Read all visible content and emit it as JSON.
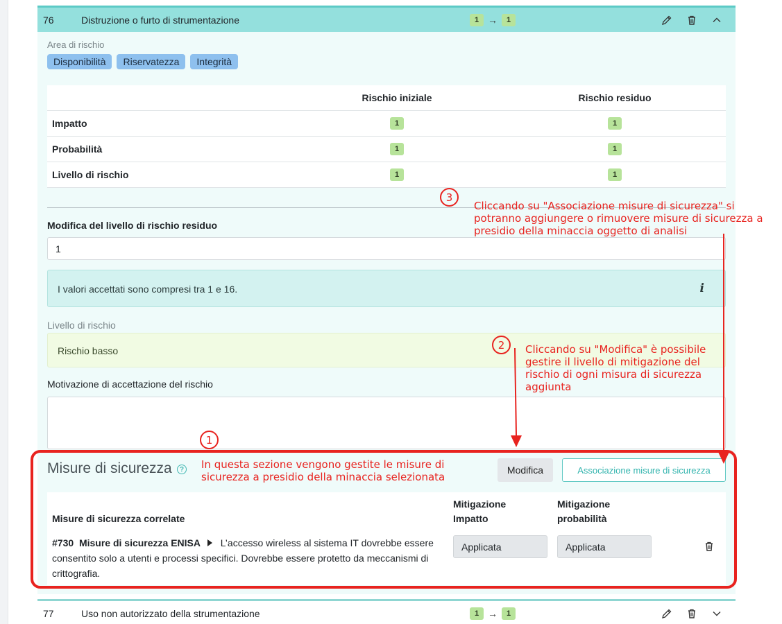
{
  "threat_open": {
    "number": "76",
    "title": "Distruzione o furto di strumentazione",
    "risk_initial": "1",
    "risk_residual": "1"
  },
  "area": {
    "label": "Area di rischio",
    "chips": [
      "Disponibilità",
      "Riservatezza",
      "Integrità"
    ]
  },
  "risk_table": {
    "col_initial": "Rischio iniziale",
    "col_residual": "Rischio residuo",
    "rows": [
      {
        "label": "Impatto",
        "initial": "1",
        "residual": "1"
      },
      {
        "label": "Probabilità",
        "initial": "1",
        "residual": "1"
      },
      {
        "label": "Livello di rischio",
        "initial": "1",
        "residual": "1"
      }
    ]
  },
  "modify": {
    "label": "Modifica del livello di rischio residuo",
    "value": "1",
    "info": "I valori accettati sono compresi tra 1 e 16."
  },
  "level": {
    "label": "Livello di rischio",
    "value": "Rischio basso"
  },
  "motivation": {
    "label": "Motivazione di accettazione del rischio"
  },
  "misure": {
    "title": "Misure di sicurezza",
    "btn_modifica": "Modifica",
    "btn_associazione": "Associazione misure di sicurezza",
    "col_related": "Misure di sicurezza correlate",
    "col_mit_impact": "Mitigazione Impatto",
    "col_mit_prob": "Mitigazione probabilità",
    "item": {
      "id": "#730",
      "source": "Misure di sicurezza ENISA",
      "text": "L’accesso wireless al sistema IT dovrebbe essere consentito solo a utenti e processi specifici. Dovrebbe essere protetto da meccanismi di crittografia.",
      "mit_impact": "Applicata",
      "mit_prob": "Applicata"
    }
  },
  "threat_next": {
    "number": "77",
    "title": "Uso non autorizzato della strumentazione",
    "risk_initial": "1",
    "risk_residual": "1"
  },
  "annotations": {
    "n1": "1",
    "t1": "In questa sezione vengono gestite le misure di sicurezza a presidio della minaccia selezionata",
    "n2": "2",
    "t2": "Cliccando su \"Modifica\" è possibile gestire il livello di mitigazione del rischio di ogni misura di sicurezza aggiunta",
    "n3": "3",
    "t3": "Cliccando su \"Associazione misure di sicurezza\" si potranno aggiungere o rimuovere misure di sicurezza a presidio della minaccia oggetto di analisi"
  },
  "colors": {
    "header_teal": "#94e0dd",
    "annotation_red": "#e8231f",
    "pill_green": "#b7e39a",
    "chip_blue": "#8ec0ee"
  }
}
